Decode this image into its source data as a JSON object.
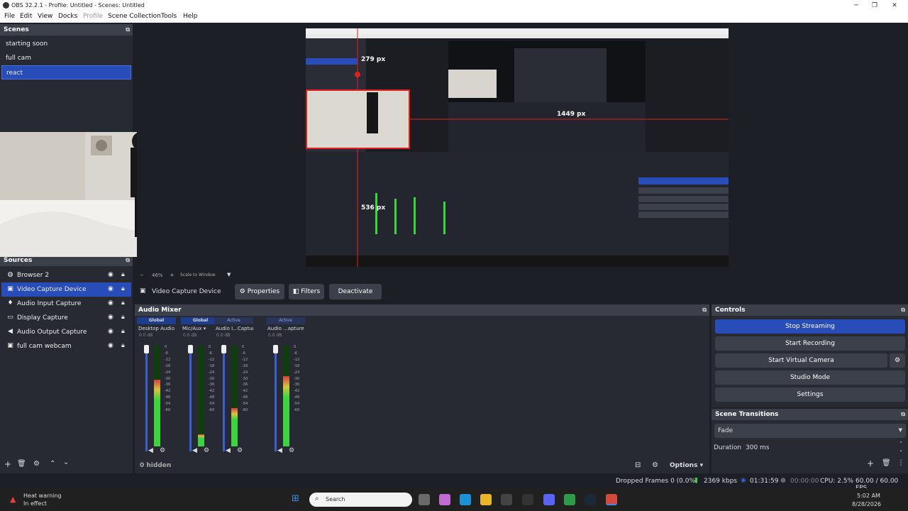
{
  "window": {
    "title": "OBS 32.2.1 - Profile: Untitled - Scenes: Untitled"
  },
  "menu": [
    "File",
    "Edit",
    "View",
    "Docks",
    "Profile",
    "Scene Collection",
    "Tools",
    "Help"
  ],
  "scenes": {
    "title": "Scenes",
    "items": [
      "starting soon",
      "full cam",
      "react"
    ],
    "selected": "react"
  },
  "sources": {
    "title": "Sources",
    "items": [
      {
        "label": "Browser 2",
        "icon": "globe-icon"
      },
      {
        "label": "Video Capture Device",
        "icon": "camera-icon"
      },
      {
        "label": "Audio Input Capture",
        "icon": "microphone-icon"
      },
      {
        "label": "Display Capture",
        "icon": "monitor-icon"
      },
      {
        "label": "Audio Output Capture",
        "icon": "speaker-icon"
      },
      {
        "label": "full cam webcam",
        "icon": "camera-icon"
      }
    ],
    "selected": "Video Capture Device"
  },
  "preview": {
    "measure_top": "279 px",
    "measure_right": "1449 px",
    "measure_bottom": "536 px",
    "zoom": "46%",
    "scale_mode": "Scale to Window"
  },
  "context_bar": {
    "source_name": "Video Capture Device",
    "properties": "Properties",
    "filters": "Filters",
    "deactivate": "Deactivate"
  },
  "mixer": {
    "title": "Audio Mixer",
    "channels": [
      {
        "tag": "Global",
        "name": "Desktop Audio",
        "db": "0.0 dB",
        "level": 0.66
      },
      {
        "tag": "Global",
        "name": "Mic/Aux",
        "db": "0.0 dB",
        "level": 0.12
      },
      {
        "tag": "Active",
        "name": "Audio I...Capture",
        "db": "0.0 dB",
        "level": 0.38
      },
      {
        "tag": "Active",
        "name": "Audio ...apture",
        "db": "0.0 dB",
        "level": 0.7
      }
    ],
    "scale": [
      "0",
      "-6",
      "-12",
      "-18",
      "-24",
      "-30",
      "-36",
      "-42",
      "-48",
      "-54",
      "-60"
    ],
    "hidden_label": "0 hidden",
    "options_label": "Options"
  },
  "controls": {
    "title": "Controls",
    "stop_streaming": "Stop Streaming",
    "start_recording": "Start Recording",
    "start_virtual_camera": "Start Virtual Camera",
    "studio_mode": "Studio Mode",
    "settings": "Settings"
  },
  "transitions": {
    "title": "Scene Transitions",
    "selected": "Fade",
    "duration_label": "Duration",
    "duration_value": "300 ms"
  },
  "status": {
    "dropped_frames": "Dropped Frames 0 (0.0%)",
    "bitrate": "2369 kbps",
    "stream_time": "01:31:59",
    "rec_time": "00:00:00",
    "cpu": "CPU: 2.5%",
    "fps": "60.00 / 60.00 FPS"
  },
  "taskbar": {
    "warning_title": "Heat warning",
    "warning_sub": "In effect",
    "search_placeholder": "Search",
    "time": "5:02 AM",
    "date": "8/28/2026"
  },
  "colors": {
    "accent": "#284cb8",
    "bg": "#1d1f26",
    "panel": "#272a33",
    "header": "#3c404b",
    "meter_green": "#3fd43f",
    "meter_yellow": "#d4c43f",
    "meter_red": "#d43f3f"
  }
}
